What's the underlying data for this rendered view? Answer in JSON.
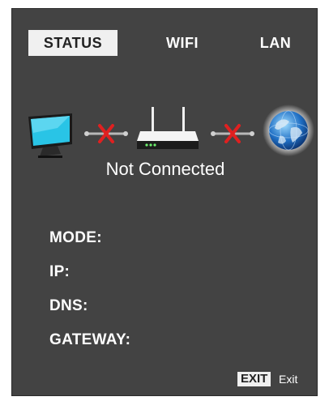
{
  "tabs": [
    {
      "label": "STATUS",
      "active": true
    },
    {
      "label": "WIFI",
      "active": false
    },
    {
      "label": "LAN",
      "active": false
    }
  ],
  "connection": {
    "status_text": "Not Connected",
    "icons": [
      "tv-icon",
      "disconnected-link-icon",
      "router-icon",
      "disconnected-link-icon",
      "globe-icon"
    ]
  },
  "info": {
    "mode_label": "MODE:",
    "ip_label": "IP:",
    "dns_label": "DNS:",
    "gateway_label": "GATEWAY:"
  },
  "footer": {
    "exit_key": "EXIT",
    "exit_label": "Exit"
  },
  "colors": {
    "panel_bg": "#434343",
    "active_tab_bg": "#f0f0f0",
    "text": "#ffffff",
    "error_x": "#e02020"
  }
}
